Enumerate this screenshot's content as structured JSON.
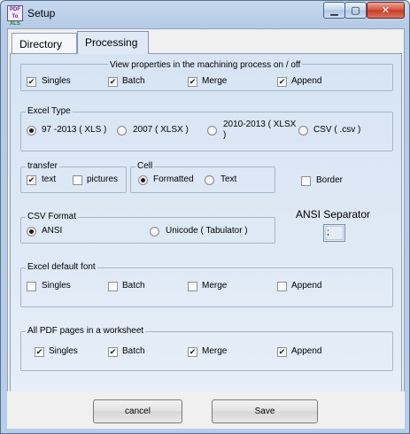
{
  "window": {
    "title": "Setup",
    "icon_text": [
      "PDF",
      "To",
      "XLS"
    ]
  },
  "tabs": [
    {
      "label": "Directory",
      "active": false
    },
    {
      "label": "Processing",
      "active": true
    }
  ],
  "view_properties": {
    "title": "View properties in the machining process on / off",
    "items": [
      {
        "label": "Singles",
        "checked": true
      },
      {
        "label": "Batch",
        "checked": true
      },
      {
        "label": "Merge",
        "checked": true
      },
      {
        "label": "Append",
        "checked": true
      }
    ]
  },
  "excel_type": {
    "title": "Excel Type",
    "options": [
      {
        "label": "97 -2013 (  XLS )",
        "selected": true
      },
      {
        "label": "2007 ( XLSX  )",
        "selected": false
      },
      {
        "label": "2010-2013 ( XLSX )",
        "label_line1": "2010-2013  ( XLSX",
        "label_line2": ")",
        "selected": false
      },
      {
        "label": "CSV  ( .csv )",
        "selected": false
      }
    ]
  },
  "transfer": {
    "title": "transfer",
    "items": [
      {
        "label": "text",
        "checked": true
      },
      {
        "label": "pictures",
        "checked": false
      }
    ]
  },
  "cell": {
    "title": "Cell",
    "options": [
      {
        "label": "Formatted",
        "selected": true
      },
      {
        "label": "Text",
        "selected": false
      }
    ]
  },
  "border": {
    "label": "Border",
    "checked": false
  },
  "csv_format": {
    "title": "CSV Format",
    "options": [
      {
        "label": "ANSI",
        "selected": true
      },
      {
        "label": "Unicode ( Tabulator )",
        "selected": false
      }
    ]
  },
  "ansi_separator": {
    "label": "ANSI Separator",
    "value": ";"
  },
  "excel_default_font": {
    "title": "Excel default font",
    "items": [
      {
        "label": "Singles",
        "checked": false
      },
      {
        "label": "Batch",
        "checked": false
      },
      {
        "label": "Merge",
        "checked": false
      },
      {
        "label": "Append",
        "checked": false
      }
    ]
  },
  "all_pdf_pages": {
    "title": "All PDF pages in a worksheet",
    "items": [
      {
        "label": "Singles",
        "checked": true
      },
      {
        "label": "Batch",
        "checked": true
      },
      {
        "label": "Merge",
        "checked": true
      },
      {
        "label": "Append",
        "checked": true
      }
    ]
  },
  "buttons": {
    "cancel": "cancel",
    "save": "Save"
  },
  "icons": {
    "minimize": "minimize-icon",
    "maximize": "maximize-icon",
    "close": "close-icon",
    "check": "✔"
  }
}
